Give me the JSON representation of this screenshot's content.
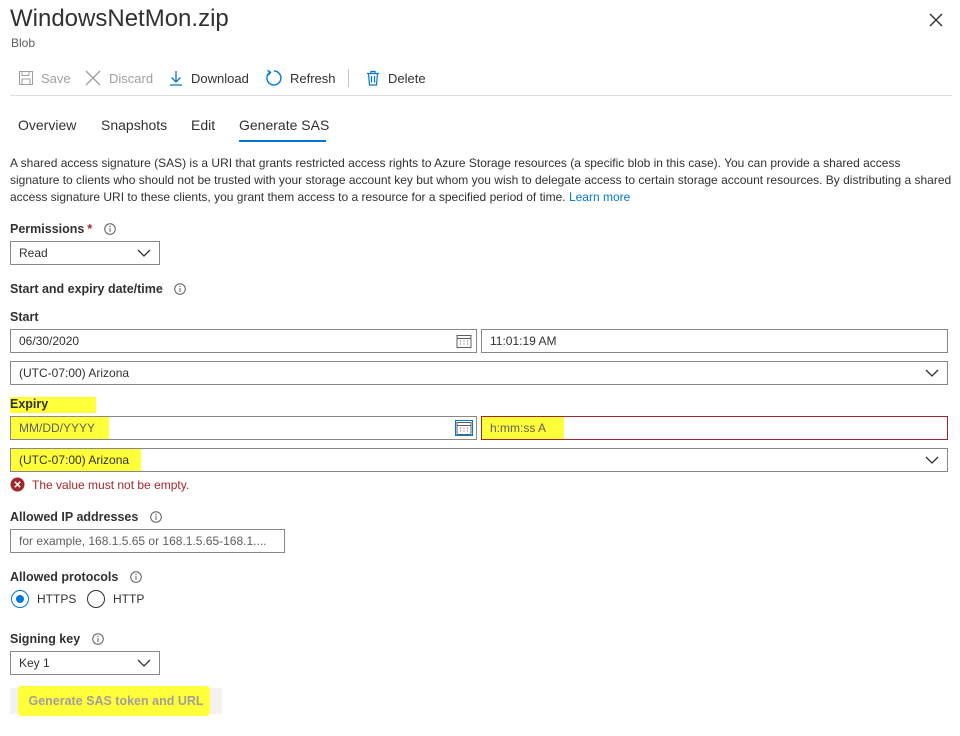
{
  "header": {
    "title": "WindowsNetMon.zip",
    "subtitle": "Blob"
  },
  "toolbar": {
    "save_label": "Save",
    "discard_label": "Discard",
    "download_label": "Download",
    "refresh_label": "Refresh",
    "delete_label": "Delete"
  },
  "tabs": [
    {
      "label": "Overview"
    },
    {
      "label": "Snapshots"
    },
    {
      "label": "Edit"
    },
    {
      "label": "Generate SAS",
      "active": true
    }
  ],
  "description": {
    "text": "A shared access signature (SAS) is a URI that grants restricted access rights to Azure Storage resources (a specific blob in this case). You can provide a shared access signature to clients who should not be trusted with your storage account key but whom you wish to delegate access to certain storage account resources. By distributing a shared access signature URI to these clients, you grant them access to a resource for a specified period of time.",
    "link": "Learn more"
  },
  "permissions": {
    "label": "Permissions",
    "required_mark": "*",
    "value": "Read"
  },
  "start_expiry": {
    "label": "Start and expiry date/time"
  },
  "start": {
    "label": "Start",
    "date": "06/30/2020",
    "time": "11:01:19 AM",
    "timezone": "(UTC-07:00) Arizona"
  },
  "expiry": {
    "label": "Expiry",
    "date_placeholder": "MM/DD/YYYY",
    "time_placeholder": "h:mm:ss A",
    "timezone": "(UTC-07:00) Arizona",
    "error": "The value must not be empty."
  },
  "allowed_ip": {
    "label": "Allowed IP addresses",
    "placeholder": "for example, 168.1.5.65 or 168.1.5.65-168.1...."
  },
  "protocols": {
    "label": "Allowed protocols",
    "options": [
      {
        "label": "HTTPS",
        "selected": true
      },
      {
        "label": "HTTP",
        "selected": false
      }
    ]
  },
  "signing_key": {
    "label": "Signing key",
    "value": "Key 1"
  },
  "generate_button": {
    "label": "Generate SAS token and URL"
  },
  "colors": {
    "accent": "#0078d4",
    "error": "#a4262c",
    "highlight": "#ffff3a"
  }
}
